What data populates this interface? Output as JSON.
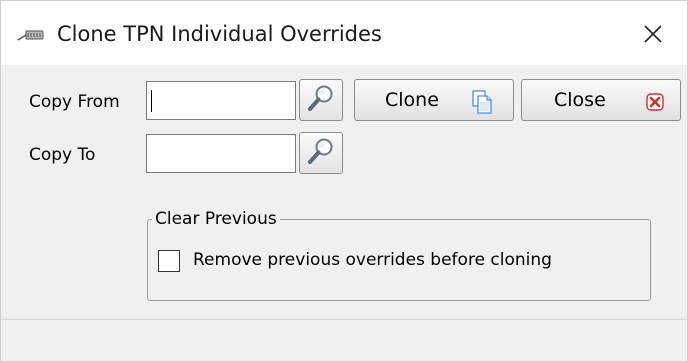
{
  "window": {
    "title": "Clone TPN Individual Overrides",
    "title_icon": "tpn-bag-icon",
    "close_icon": "close-icon"
  },
  "form": {
    "copy_from_label": "Copy From",
    "copy_from_value": "",
    "copy_to_label": "Copy To",
    "copy_to_value": "",
    "lookup_icon": "magnifier-icon"
  },
  "buttons": {
    "clone_label": "Clone",
    "clone_icon": "copy-document-icon",
    "close_label": "Close",
    "close_icon": "red-x-icon"
  },
  "clear_previous": {
    "legend": "Clear Previous",
    "checkbox_label": "Remove previous overrides before cloning",
    "checked": false
  },
  "colors": {
    "close_red": "#d0312d",
    "clone_blue": "#4a90d9",
    "magnifier_handle": "#5a6b7d"
  }
}
